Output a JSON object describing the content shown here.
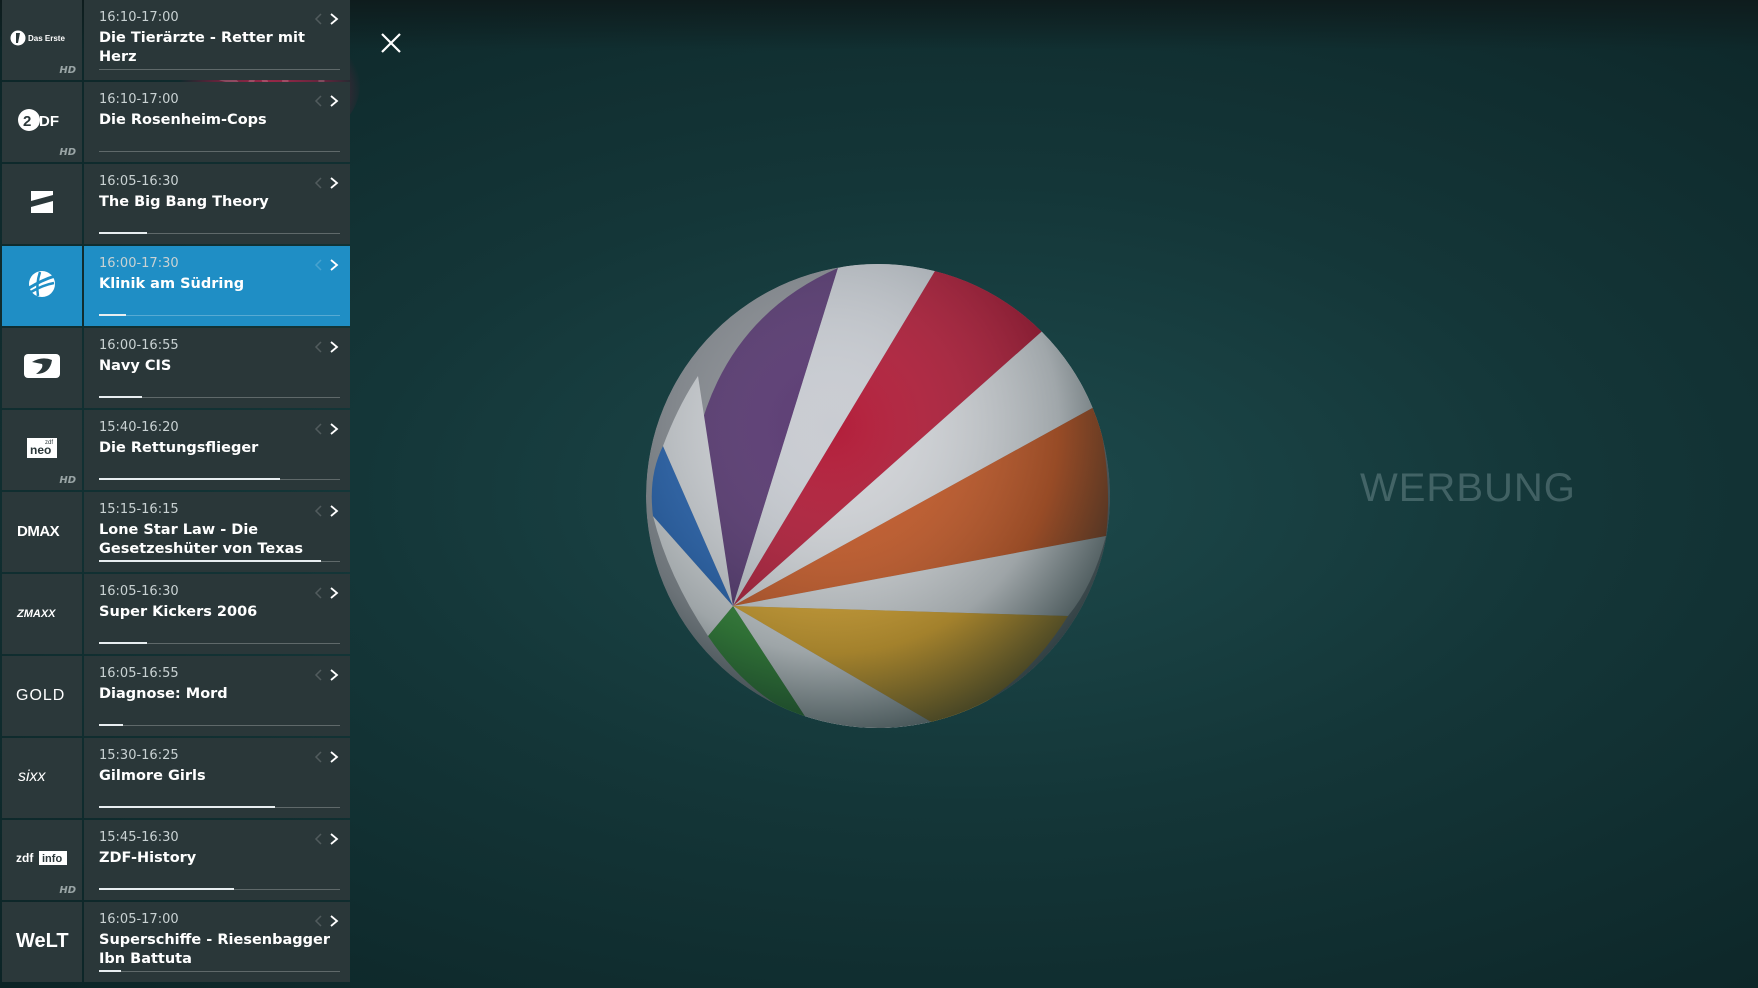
{
  "video": {
    "channel_logo_text": "SAT.1",
    "ad_label": "WERBUNG"
  },
  "close_icon": "close-icon",
  "colors": {
    "accent": "#1f8ec5",
    "row_bg": "#2a3739",
    "logo_bg": "#2b383a"
  },
  "channels": [
    {
      "logo": "Das Erste",
      "logo_icon": "das-erste-logo",
      "hd": "HD",
      "time": "16:10-17:00",
      "title": "Die Tierärzte - Retter mit Herz",
      "progress": 0.0
    },
    {
      "logo": "ZDF",
      "logo_icon": "zdf-logo",
      "hd": "HD",
      "time": "16:10-17:00",
      "title": "Die Rosenheim-Cops",
      "progress": 0.0
    },
    {
      "logo": "ProSieben",
      "logo_icon": "prosieben-logo",
      "hd": "",
      "time": "16:05-16:30",
      "title": "The Big Bang Theory",
      "progress": 0.2
    },
    {
      "logo": "SAT.1",
      "logo_icon": "sat1-logo",
      "hd": "",
      "time": "16:00-17:30",
      "title": "Klinik am Südring",
      "progress": 0.11,
      "selected": true
    },
    {
      "logo": "kabel eins",
      "logo_icon": "kabel-eins-logo",
      "hd": "",
      "time": "16:00-16:55",
      "title": "Navy CIS",
      "progress": 0.18
    },
    {
      "logo": "neo",
      "logo_icon": "zdfneo-logo",
      "hd": "HD",
      "time": "15:40-16:20",
      "title": "Die Rettungsflieger",
      "progress": 0.75
    },
    {
      "logo": "DMAX",
      "logo_icon": "dmax-logo",
      "hd": "",
      "time": "15:15-16:15",
      "title": "Lone Star Law - Die Gesetzeshüter von Texas",
      "progress": 0.92
    },
    {
      "logo": "ZMAXX",
      "logo_icon": "tele5-logo",
      "hd": "",
      "time": "16:05-16:30",
      "title": "Super Kickers 2006",
      "progress": 0.2
    },
    {
      "logo": "GOLD",
      "logo_icon": "gold-logo",
      "hd": "",
      "time": "16:05-16:55",
      "title": "Diagnose: Mord",
      "progress": 0.1
    },
    {
      "logo": "sixx",
      "logo_icon": "sixx-logo",
      "hd": "",
      "time": "15:30-16:25",
      "title": "Gilmore Girls",
      "progress": 0.73
    },
    {
      "logo": "zdfinfo",
      "logo_icon": "zdfinfo-logo",
      "hd": "HD",
      "time": "15:45-16:30",
      "title": "ZDF-History",
      "progress": 0.56
    },
    {
      "logo": "WELT",
      "logo_icon": "welt-logo",
      "hd": "",
      "time": "16:05-17:00",
      "title": "Superschiffe - Riesenbagger Ibn Battuta",
      "progress": 0.09
    }
  ]
}
